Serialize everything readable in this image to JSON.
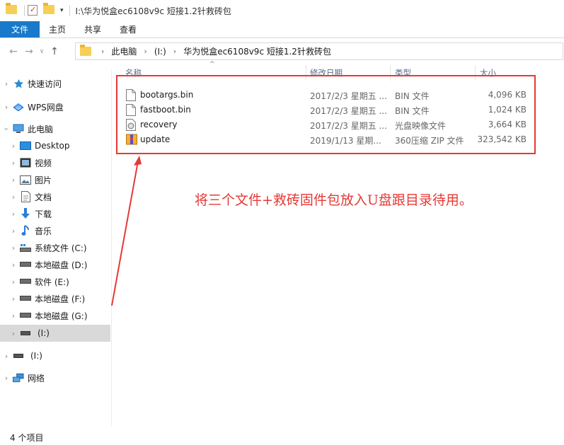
{
  "titlebar": {
    "path": "I:\\华为悦盒ec6108v9c 短接1.2针救砖包",
    "dropdown_glyph": "▾"
  },
  "ribbon": {
    "tabs": [
      {
        "label": "文件"
      },
      {
        "label": "主页"
      },
      {
        "label": "共享"
      },
      {
        "label": "查看"
      }
    ]
  },
  "nav": {
    "back": "←",
    "forward": "→",
    "recent": "∨",
    "up": "↑",
    "breadcrumb": [
      "此电脑",
      "(I:)",
      "华为悦盒ec6108v9c 短接1.2针救砖包"
    ],
    "crumb_sep": "›"
  },
  "sidebar": {
    "items": [
      {
        "label": "快速访问",
        "icon": "star-icon"
      },
      {
        "label": "WPS网盘",
        "icon": "cloud-icon"
      },
      {
        "label": "此电脑",
        "icon": "computer-icon"
      },
      {
        "label": "Desktop",
        "icon": "desktop-icon"
      },
      {
        "label": "视频",
        "icon": "video-icon"
      },
      {
        "label": "图片",
        "icon": "picture-icon"
      },
      {
        "label": "文档",
        "icon": "document-icon"
      },
      {
        "label": "下载",
        "icon": "download-icon"
      },
      {
        "label": "音乐",
        "icon": "music-icon"
      },
      {
        "label": "系统文件 (C:)",
        "icon": "system-drive-icon"
      },
      {
        "label": "本地磁盘 (D:)",
        "icon": "drive-icon"
      },
      {
        "label": "软件 (E:)",
        "icon": "drive-icon"
      },
      {
        "label": "本地磁盘 (F:)",
        "icon": "drive-icon"
      },
      {
        "label": "本地磁盘 (G:)",
        "icon": "drive-icon"
      },
      {
        "label": "(I:)",
        "icon": "usb-drive-icon"
      },
      {
        "label": "(I:)",
        "icon": "usb-drive-icon"
      },
      {
        "label": "网络",
        "icon": "network-icon"
      }
    ]
  },
  "columns": {
    "name": "名称",
    "date": "修改日期",
    "type": "类型",
    "size": "大小",
    "sort_glyph": "^"
  },
  "files": [
    {
      "name": "bootargs.bin",
      "date": "2017/2/3 星期五 ...",
      "type": "BIN 文件",
      "size": "4,096 KB",
      "icon": "file-icon"
    },
    {
      "name": "fastboot.bin",
      "date": "2017/2/3 星期五 ...",
      "type": "BIN 文件",
      "size": "1,024 KB",
      "icon": "file-icon"
    },
    {
      "name": "recovery",
      "date": "2017/2/3 星期五 ...",
      "type": "光盘映像文件",
      "size": "3,664 KB",
      "icon": "disc-image-icon"
    },
    {
      "name": "update",
      "date": "2019/1/13 星期...",
      "type": "360压缩 ZIP 文件",
      "size": "323,542 KB",
      "icon": "zip-archive-icon"
    }
  ],
  "annotation": {
    "text": "将三个文件+救砖固件包放入U盘跟目录待用。"
  },
  "status": {
    "count": "4 个项目"
  },
  "colors": {
    "accent": "#1979ca",
    "highlight": "#e53935",
    "folder": "#f6cf57"
  }
}
